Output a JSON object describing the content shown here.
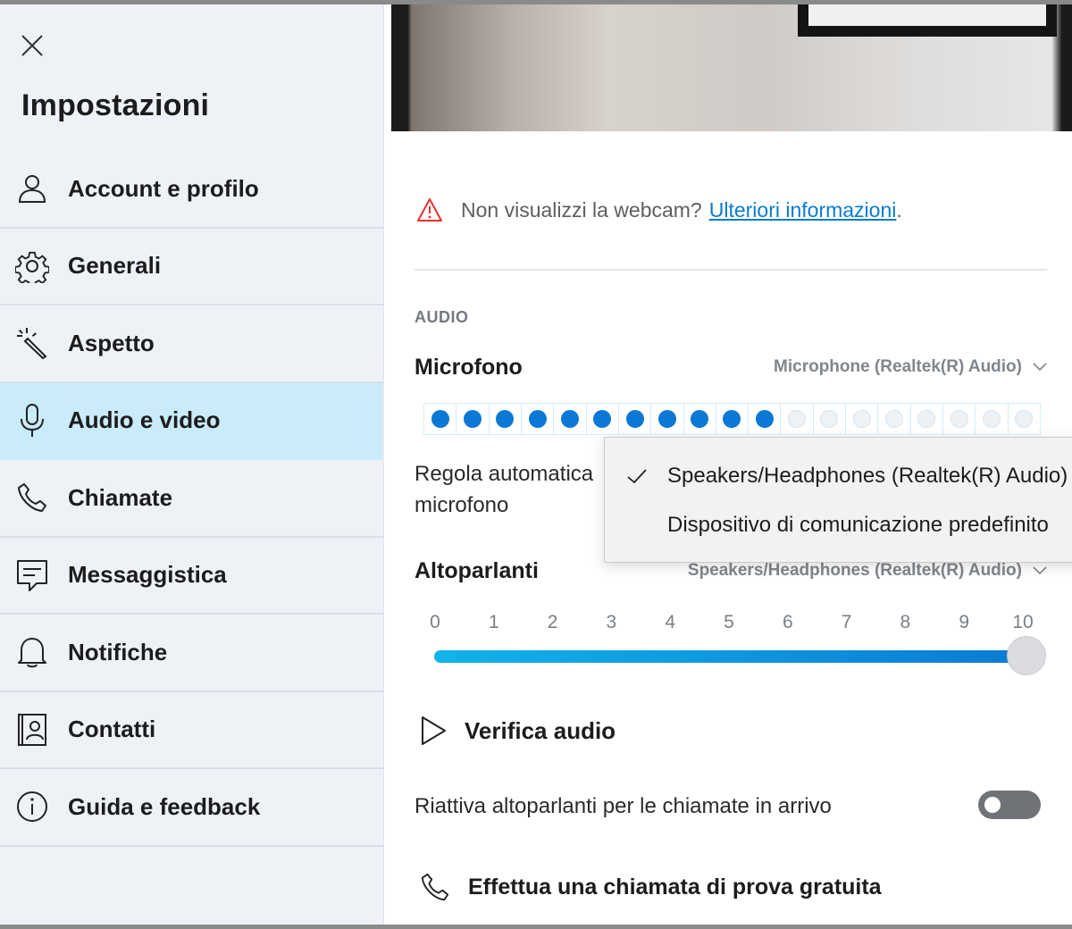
{
  "sidebar": {
    "close_icon": "close-icon",
    "title": "Impostazioni",
    "items": [
      {
        "label": "Account e profilo",
        "icon": "person-icon"
      },
      {
        "label": "Generali",
        "icon": "gear-icon"
      },
      {
        "label": "Aspetto",
        "icon": "magic-wand-icon"
      },
      {
        "label": "Audio e video",
        "icon": "microphone-icon",
        "active": true
      },
      {
        "label": "Chiamate",
        "icon": "phone-icon"
      },
      {
        "label": "Messaggistica",
        "icon": "message-icon"
      },
      {
        "label": "Notifiche",
        "icon": "bell-icon"
      },
      {
        "label": "Contatti",
        "icon": "contact-card-icon"
      },
      {
        "label": "Guida e feedback",
        "icon": "info-icon"
      }
    ]
  },
  "main": {
    "warning": {
      "text": "Non visualizzi la webcam?",
      "link": "Ulteriori informazioni",
      "suffix": ".",
      "icon": "warning-icon"
    },
    "audio_section_label": "AUDIO",
    "microphone": {
      "title": "Microfono",
      "device": "Microphone (Realtek(R) Audio)",
      "level_total": 19,
      "level_active": 11
    },
    "auto_adjust_label": "Regola automatica microfono",
    "dropdown": {
      "items": [
        {
          "label": "Speakers/Headphones (Realtek(R) Audio)",
          "checked": true
        },
        {
          "label": "Dispositivo di comunicazione predefinito",
          "checked": false
        }
      ]
    },
    "speakers": {
      "title": "Altoparlanti",
      "device": "Speakers/Headphones (Realtek(R) Audio)",
      "scale": [
        "0",
        "1",
        "2",
        "3",
        "4",
        "5",
        "6",
        "7",
        "8",
        "9",
        "10"
      ],
      "volume": 10
    },
    "verify_audio_label": "Verifica audio",
    "unmute_label": "Riattiva altoparlanti per le chiamate in arrivo",
    "unmute_enabled": false,
    "test_call_label": "Effettua una chiamata di prova gratuita"
  },
  "colors": {
    "accent": "#0a78d4",
    "link": "#0a7bd1",
    "warning": "#e3342f",
    "active_nav": "#c9ebfa",
    "sidebar_bg": "#eef2f7"
  }
}
